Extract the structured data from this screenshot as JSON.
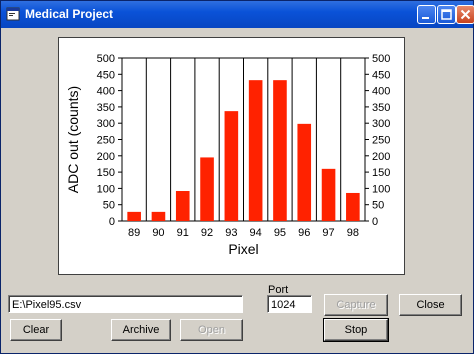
{
  "window": {
    "title": "Medical Project"
  },
  "chart_data": {
    "type": "bar",
    "categories": [
      "89",
      "90",
      "91",
      "92",
      "93",
      "94",
      "95",
      "96",
      "97",
      "98"
    ],
    "values": [
      28,
      28,
      92,
      195,
      337,
      432,
      432,
      298,
      160,
      86
    ],
    "title": "",
    "xlabel": "Pixel",
    "ylabel": "ADC out (counts)",
    "ylim": [
      0,
      500
    ],
    "yticks": [
      "0",
      "50",
      "100",
      "150",
      "200",
      "250",
      "300",
      "350",
      "400",
      "450",
      "500"
    ],
    "grid": "vertical",
    "bar_color": "#ff2200",
    "right_axis": true
  },
  "controls": {
    "file_path": "E:\\Pixel95.csv",
    "port_label": "Port",
    "port_value": "1024",
    "capture_label": "Capture",
    "close_label": "Close",
    "clear_label": "Clear",
    "archive_label": "Archive",
    "open_label": "Open",
    "stop_label": "Stop"
  }
}
